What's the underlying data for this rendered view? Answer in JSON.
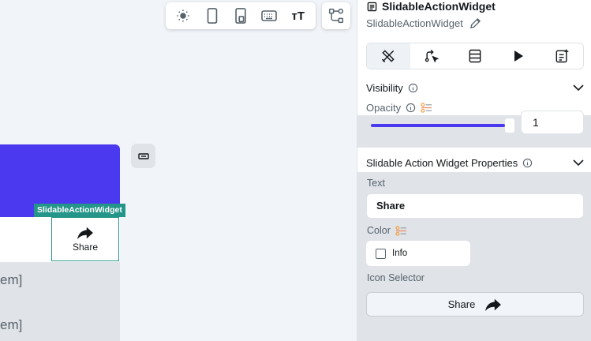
{
  "canvas": {
    "badge_label": "SlidableActionWidget",
    "share_label": "Share",
    "list_items": [
      "em]",
      "em]"
    ]
  },
  "toolbar": {
    "icons": [
      "sun-icon",
      "phone-icon",
      "tablet-icon",
      "keyboard-icon",
      "text-size-icon",
      "widget-tree-icon"
    ],
    "text_size_label": "тT"
  },
  "panel": {
    "title": "SlidableActionWidget",
    "name": "SlidableActionWidget",
    "tabs": [
      "properties",
      "actions",
      "backend-query",
      "run",
      "generate"
    ],
    "visibility": {
      "label": "Visibility",
      "opacity_label": "Opacity",
      "opacity_value": "1",
      "opacity_fraction": 1.0
    },
    "props": {
      "header": "Slidable Action Widget Properties",
      "text_label": "Text",
      "text_value": "Share",
      "color_label": "Color",
      "color_value": "Info",
      "icon_label": "Icon Selector",
      "icon_value": "Share"
    }
  },
  "colors": {
    "accent": "#4b39ef",
    "badge": "#249689"
  }
}
